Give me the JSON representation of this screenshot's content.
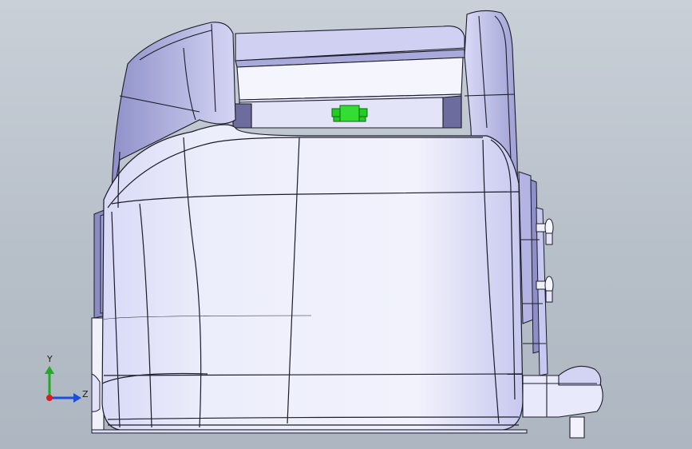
{
  "viewport": {
    "name": "cad-3d-viewport",
    "background_top": "#c9d0d8",
    "background_bottom": "#aeb6c1",
    "model_face_color": "#eef0fa",
    "model_shade_color": "#c9cbf0",
    "edge_color": "#1c1c2a",
    "selected_part_color": "#22cc22"
  },
  "triad": {
    "y_label": "Y",
    "z_label": "Z",
    "y_color": "#22aa22",
    "z_color": "#1a4fd6",
    "origin_color": "#d62020"
  }
}
